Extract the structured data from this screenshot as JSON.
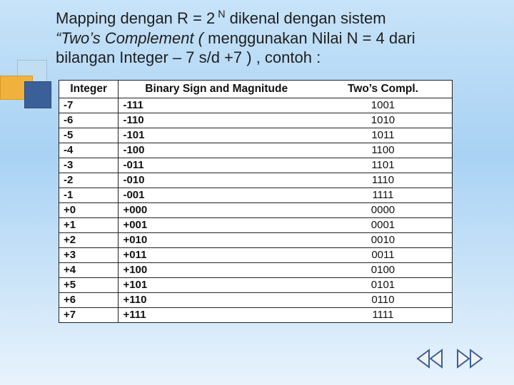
{
  "text": {
    "line_a1": "Mapping dengan  R  =  2",
    "line_a_sup": " N",
    "line_a2": "  dikenal dengan sistem",
    "line_b_ital": "“Two’s Complement (",
    "line_b_rest": " menggunakan Nilai N = 4 dari",
    "line_c": "bilangan Integer – 7 s/d +7 ) , contoh :"
  },
  "headers": {
    "c1": "Integer",
    "c2": "Binary Sign and Magnitude",
    "c3": "Two’s Compl."
  },
  "chart_data": {
    "type": "table",
    "columns": [
      "Integer",
      "Binary Sign and Magnitude",
      "Two's Compl."
    ],
    "rows": [
      {
        "integer": "-7",
        "signmag": "-111",
        "twos": "1001"
      },
      {
        "integer": "-6",
        "signmag": "-110",
        "twos": "1010"
      },
      {
        "integer": "-5",
        "signmag": "-101",
        "twos": "1011"
      },
      {
        "integer": "-4",
        "signmag": "-100",
        "twos": "1100"
      },
      {
        "integer": "-3",
        "signmag": "-011",
        "twos": "1101"
      },
      {
        "integer": "-2",
        "signmag": "-010",
        "twos": "1110"
      },
      {
        "integer": "-1",
        "signmag": "-001",
        "twos": "1111"
      },
      {
        "integer": "+0",
        "signmag": "+000",
        "twos": "0000"
      },
      {
        "integer": "+1",
        "signmag": "+001",
        "twos": "0001"
      },
      {
        "integer": "+2",
        "signmag": "+010",
        "twos": "0010"
      },
      {
        "integer": "+3",
        "signmag": "+011",
        "twos": "0011"
      },
      {
        "integer": "+4",
        "signmag": "+100",
        "twos": "0100"
      },
      {
        "integer": "+5",
        "signmag": "+101",
        "twos": "0101"
      },
      {
        "integer": "+6",
        "signmag": "+110",
        "twos": "0110"
      },
      {
        "integer": "+7",
        "signmag": "+111",
        "twos": "1111"
      }
    ]
  }
}
